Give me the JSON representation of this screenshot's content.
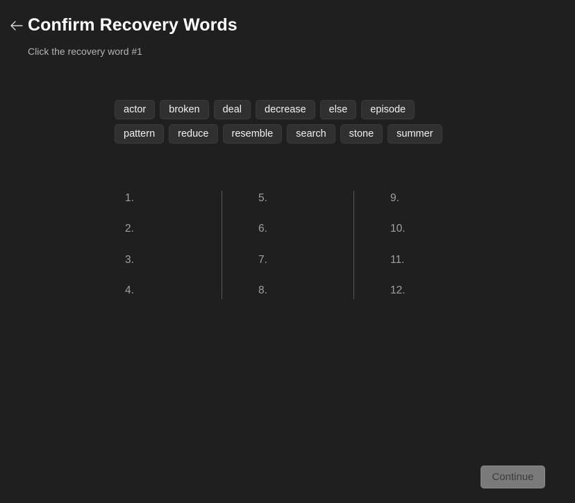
{
  "header": {
    "back_icon": "arrow-left-icon",
    "title": "Confirm Recovery Words",
    "subtitle": "Click the recovery word #1"
  },
  "word_choices": {
    "row1": [
      "actor",
      "broken",
      "deal",
      "decrease",
      "else",
      "episode"
    ],
    "row2": [
      "pattern",
      "reduce",
      "resemble",
      "search",
      "stone",
      "summer"
    ]
  },
  "slots": {
    "columns": [
      [
        "1.",
        "2.",
        "3.",
        "4."
      ],
      [
        "5.",
        "6.",
        "7.",
        "8."
      ],
      [
        "9.",
        "10.",
        "11.",
        "12."
      ]
    ]
  },
  "footer": {
    "continue_label": "Continue",
    "continue_enabled": false
  }
}
